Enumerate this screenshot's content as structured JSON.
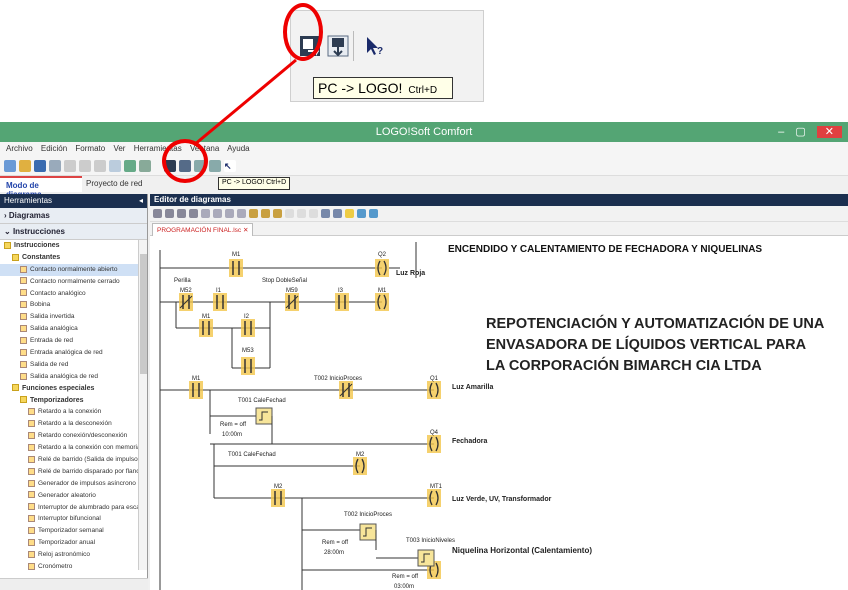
{
  "zoom": {
    "tooltip": "PC -> LOGO!",
    "shortcut": "Ctrl+D",
    "icons": [
      "pc-to-logo-icon",
      "logo-to-pc-icon",
      "context-help-icon"
    ]
  },
  "app": {
    "title": "LOGO!Soft Comfort",
    "window_controls": [
      "–",
      "▢",
      "✕"
    ],
    "menu": [
      "Archivo",
      "Edición",
      "Formato",
      "Ver",
      "Herramientas",
      "Ventana",
      "Ayuda"
    ],
    "small_tooltip": "PC -> LOGO!",
    "small_tooltip_shortcut": "Ctrl+D",
    "mode_tabs": [
      "Modo de diagrama",
      "Proyecto de red"
    ]
  },
  "left": {
    "header": "Herramientas",
    "sections": [
      "Diagramas",
      "Instrucciones"
    ],
    "tree": [
      {
        "label": "Instrucciones",
        "level": 0,
        "folder": true
      },
      {
        "label": "Constantes",
        "level": 1,
        "folder": true
      },
      {
        "label": "Contacto normalmente abierto",
        "level": 2,
        "selected": true
      },
      {
        "label": "Contacto normalmente cerrado",
        "level": 2
      },
      {
        "label": "Contacto analógico",
        "level": 2
      },
      {
        "label": "Bobina",
        "level": 2
      },
      {
        "label": "Salida invertida",
        "level": 2
      },
      {
        "label": "Salida analógica",
        "level": 2
      },
      {
        "label": "Entrada de red",
        "level": 2
      },
      {
        "label": "Entrada analógica de red",
        "level": 2
      },
      {
        "label": "Salida de red",
        "level": 2
      },
      {
        "label": "Salida analógica de red",
        "level": 2
      },
      {
        "label": "Funciones especiales",
        "level": 1,
        "folder": true
      },
      {
        "label": "Temporizadores",
        "level": 2,
        "folder": true
      },
      {
        "label": "Retardo a la conexión",
        "level": 3
      },
      {
        "label": "Retardo a la desconexión",
        "level": 3
      },
      {
        "label": "Retardo conexión/desconexión",
        "level": 3
      },
      {
        "label": "Retardo a la conexión con memoria",
        "level": 3
      },
      {
        "label": "Relé de barrido (Salida de impulsos)",
        "level": 3
      },
      {
        "label": "Relé de barrido disparado por flancos",
        "level": 3
      },
      {
        "label": "Generador de impulsos asíncrono",
        "level": 3
      },
      {
        "label": "Generador aleatorio",
        "level": 3
      },
      {
        "label": "Interruptor de alumbrado para escalera",
        "level": 3
      },
      {
        "label": "Interruptor bifuncional",
        "level": 3
      },
      {
        "label": "Temporizador semanal",
        "level": 3
      },
      {
        "label": "Temporizador anual",
        "level": 3
      },
      {
        "label": "Reloj astronómico",
        "level": 3
      },
      {
        "label": "Cronómetro",
        "level": 3
      }
    ]
  },
  "editor": {
    "header": "Editor de diagramas",
    "tab": "PROGRAMACIÓN FINAL.lsc ✕",
    "heading": "ENCENDIDO Y CALENTAMIENTO DE FECHADORA Y NIQUELINAS",
    "project_text": [
      "REPOTENCIACIÓN Y AUTOMATIZACIÓN DE UNA",
      "ENVASADORA DE LÍQUIDOS VERTICAL PARA",
      "LA CORPORACIÓN BIMARCH CIA LTDA"
    ],
    "contact_labels": {
      "m1_top": "M1",
      "q2": "Q2",
      "luz_roja": "Luz Roja",
      "perilla": "Perilla",
      "stop": "Stop DobleSeñal",
      "m52": "M52",
      "i1": "I1",
      "m59": "M59",
      "i3": "I3",
      "m1b": "M1",
      "m1c": "M1",
      "i2": "I2",
      "m53": "M53",
      "m1d": "M1",
      "t002a": "T002 InicioProces",
      "q1": "Q1",
      "luz_amarilla": "Luz Amarilla",
      "t001a": "T001 CaleFechad",
      "rem1": "Rem = off",
      "t1val": "10:00m",
      "q4": "Q4",
      "fechadora": "Fechadora",
      "t001b": "T001 CaleFechad",
      "m2": "M2",
      "m2b": "M2",
      "mt1": "MT1",
      "luz_verde": "Luz Verde, UV, Transformador",
      "t002b": "T002 InicioProces",
      "rem2": "Rem = off",
      "t2val": "28:00m",
      "t003": "T003 InicioNiveles",
      "niquelina": "Niquelina Horizontal (Calentamiento)",
      "rem3": "Rem = off",
      "t3val": "03:00m"
    }
  },
  "colors": {
    "titlebar": "#54a574",
    "panel_header": "#1b2f4f",
    "highlight": "#e00000",
    "contact": "#f3c64a"
  }
}
